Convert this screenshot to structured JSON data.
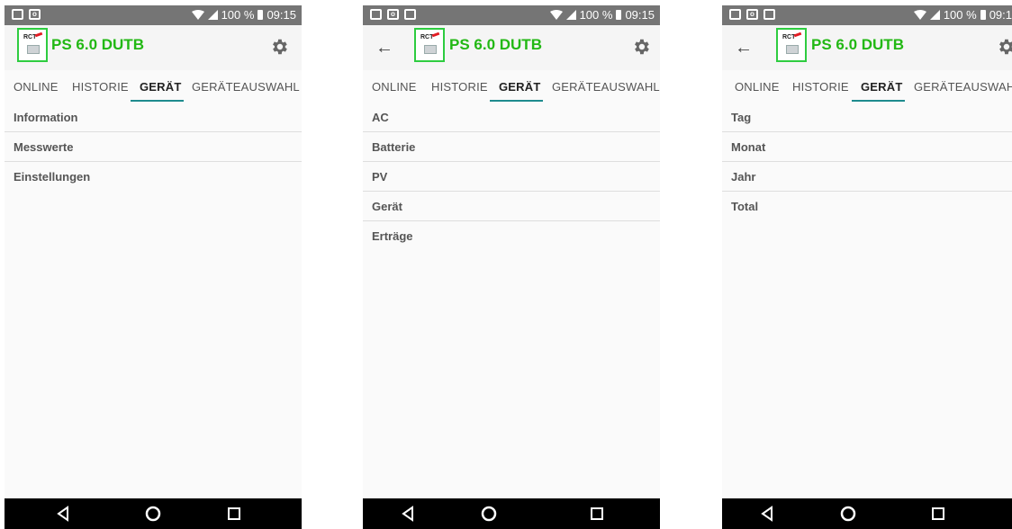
{
  "status_bar": {
    "battery_percent": "100 %",
    "time": "09:15",
    "time_right": "09:1"
  },
  "app": {
    "logo_text": "RCT",
    "title": "PS 6.0 DUTB"
  },
  "tabs": [
    "ONLINE",
    "HISTORIE",
    "GERÄT",
    "GERÄTEAUSWAHL"
  ],
  "active_tab": "GERÄT",
  "screens": [
    {
      "has_back": false,
      "items": [
        "Information",
        "Messwerte",
        "Einstellungen"
      ]
    },
    {
      "has_back": true,
      "items": [
        "AC",
        "Batterie",
        "PV",
        "Gerät",
        "Erträge"
      ]
    },
    {
      "has_back": true,
      "items": [
        "Tag",
        "Monat",
        "Jahr",
        "Total"
      ]
    }
  ],
  "colors": {
    "title_green": "#22b814",
    "highlight_box": "#2ecc40",
    "tab_indicator": "#1e8b8e",
    "status_bar": "#757575",
    "nav_bar": "#000000"
  },
  "icons": [
    "image-icon",
    "notification-icon",
    "wifi-icon",
    "signal-icon",
    "battery-icon",
    "back-arrow-icon",
    "gear-icon",
    "nav-back-icon",
    "nav-home-icon",
    "nav-recents-icon"
  ]
}
